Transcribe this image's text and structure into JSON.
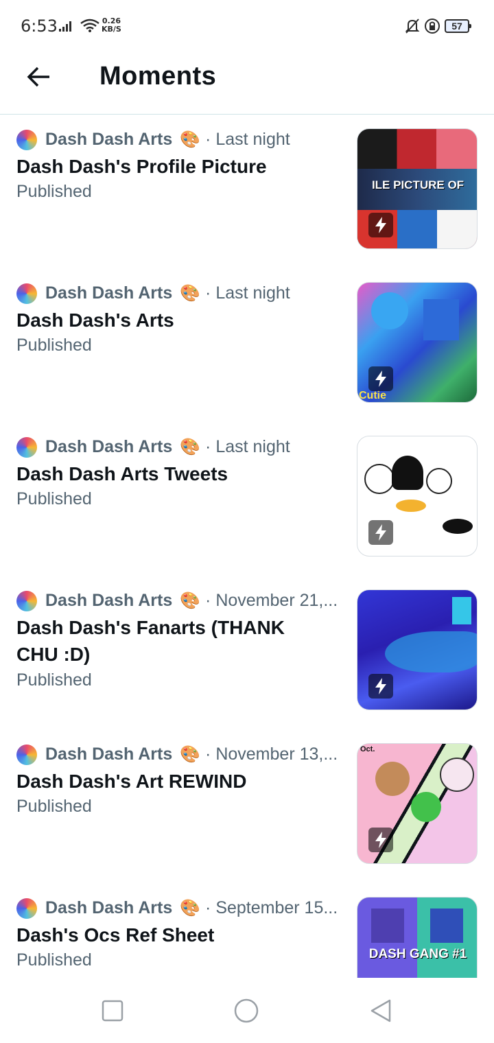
{
  "status_bar": {
    "time": "6:53",
    "speed_value": "0.26",
    "speed_unit": "KB/S",
    "battery": "57"
  },
  "header": {
    "title": "Moments"
  },
  "moments": [
    {
      "author": "Dash Dash Arts",
      "emoji": "🎨",
      "time": "· Last night",
      "title": "Dash Dash's Profile Picture",
      "status": "Published",
      "thumb_overlay": "ILE PICTURE OF"
    },
    {
      "author": "Dash Dash Arts",
      "emoji": "🎨",
      "time": "· Last night",
      "title": "Dash Dash's Arts",
      "status": "Published",
      "thumb_overlay": "Cutie"
    },
    {
      "author": "Dash Dash Arts",
      "emoji": "🎨",
      "time": "· Last night",
      "title": "Dash Dash Arts Tweets",
      "status": "Published",
      "thumb_overlay": ""
    },
    {
      "author": "Dash Dash Arts",
      "emoji": "🎨",
      "time": "· November 21,...",
      "title": "Dash Dash's Fanarts (THANK CHU :D)",
      "status": "Published",
      "thumb_overlay": ""
    },
    {
      "author": "Dash Dash Arts",
      "emoji": "🎨",
      "time": "· November 13,...",
      "title": "Dash Dash's Art REWIND",
      "status": "Published",
      "thumb_overlay": "Oct."
    },
    {
      "author": "Dash Dash Arts",
      "emoji": "🎨",
      "time": "· September 15...",
      "title": "Dash's Ocs Ref Sheet",
      "status": "Published",
      "thumb_overlay": "DASH GANG #1"
    }
  ]
}
